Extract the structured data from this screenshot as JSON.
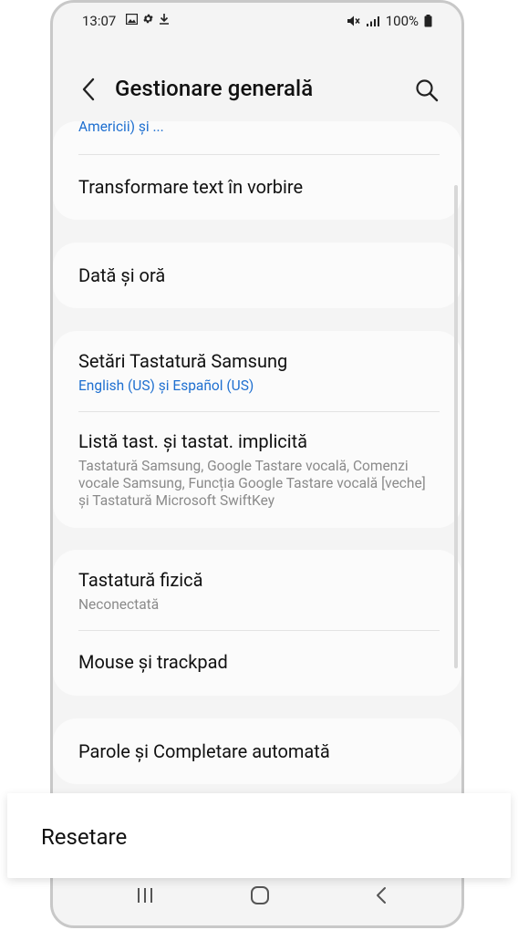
{
  "status": {
    "time": "13:07",
    "battery": "100%",
    "left_icons": [
      "image-icon",
      "gear-icon",
      "download-icon"
    ],
    "right_icons": [
      "mute-icon",
      "signal-icon",
      "battery-icon"
    ]
  },
  "header": {
    "title": "Gestionare generală"
  },
  "list": {
    "partial_top_sub": "Americii) și ...",
    "tts": {
      "title": "Transformare text în vorbire"
    },
    "datetime": {
      "title": "Dată și oră"
    },
    "samsung_keyboard": {
      "title": "Setări Tastatură Samsung",
      "sub": "English (US) și Español (US)"
    },
    "keyboard_list": {
      "title": "Listă tast. și tastat. implicită",
      "sub": "Tastatură Samsung, Google Tastare vocală, Comenzi vocale Samsung, Funcția Google Tastare vocală [veche] și Tastatură Microsoft SwiftKey"
    },
    "physical_keyboard": {
      "title": "Tastatură fizică",
      "sub": "Neconectată"
    },
    "mouse": {
      "title": "Mouse și trackpad"
    },
    "passwords": {
      "title": "Parole și Completare automată"
    }
  },
  "overlay": {
    "label": "Resetare"
  },
  "navbar": {
    "icons": [
      "recent-apps-icon",
      "home-icon",
      "back-icon"
    ]
  },
  "colors": {
    "accent": "#1e6fd0",
    "background": "#f4f4f4",
    "card": "#fbfbfb"
  }
}
